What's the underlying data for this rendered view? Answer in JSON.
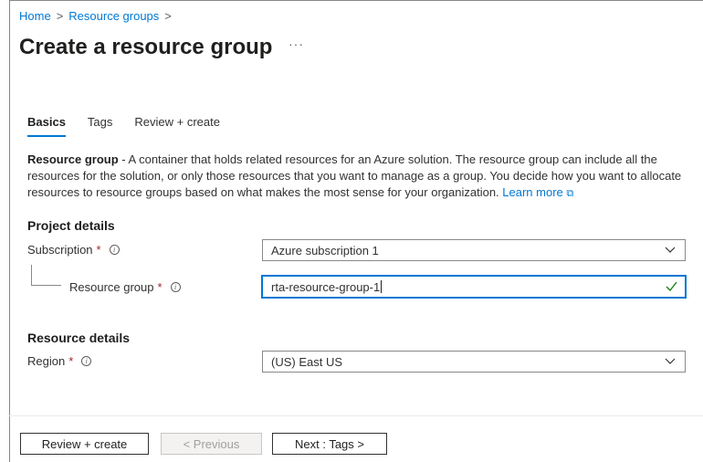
{
  "breadcrumb": {
    "home": "Home",
    "resource_groups": "Resource groups",
    "separator": ">"
  },
  "page": {
    "title": "Create a resource group",
    "more": "···"
  },
  "tabs": [
    {
      "label": "Basics",
      "active": true
    },
    {
      "label": "Tags",
      "active": false
    },
    {
      "label": "Review + create",
      "active": false
    }
  ],
  "description": {
    "term": "Resource group",
    "text": " - A container that holds related resources for an Azure solution. The resource group can include all the resources for the solution, or only those resources that you want to manage as a group. You decide how you want to allocate resources to resource groups based on what makes the most sense for your organization. ",
    "link": "Learn more",
    "link_icon": "external-link-icon"
  },
  "project_details": {
    "title": "Project details",
    "subscription": {
      "label": "Subscription",
      "required": "*",
      "value": "Azure subscription 1"
    },
    "resource_group": {
      "label": "Resource group",
      "required": "*",
      "value": "rta-resource-group-1",
      "valid": true
    }
  },
  "resource_details": {
    "title": "Resource details",
    "region": {
      "label": "Region",
      "required": "*",
      "value": "(US) East US"
    }
  },
  "footer": {
    "review_create": "Review + create",
    "previous": "< Previous",
    "next": "Next : Tags >"
  },
  "colors": {
    "accent": "#0078d4",
    "required": "#a4262c",
    "valid": "#107c10",
    "text": "#323130"
  }
}
